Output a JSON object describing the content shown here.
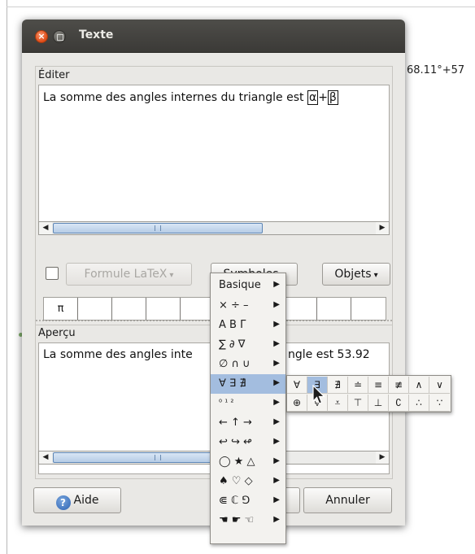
{
  "background": {
    "right_text": "68.11°+57"
  },
  "window": {
    "title": "Texte"
  },
  "edit": {
    "label": "Éditer",
    "text_prefix": "La somme des angles internes du triangle est",
    "token_alpha": "α",
    "op_plus": "+",
    "token_beta": "β",
    "scroll_left": "◀",
    "scroll_right": "▶"
  },
  "toolbar": {
    "latex_label": "Formule LaTeX",
    "symbols_label": "Symboles",
    "objects_label": "Objets",
    "dropdown_caret": "▾"
  },
  "quick_symbols": [
    "π",
    "",
    "",
    "",
    "",
    "",
    "",
    "",
    "",
    ""
  ],
  "preview": {
    "label": "Aperçu",
    "text_left": "La somme des angles inte",
    "text_right": "ngle est 53.92"
  },
  "footer": {
    "help_label": "Aide",
    "cancel_label": "Annuler"
  },
  "symbols_menu": {
    "items": [
      {
        "label": "Basique"
      },
      {
        "label": "× ÷ –"
      },
      {
        "label": "Α Β Γ"
      },
      {
        "label": "∑ ∂ ∇"
      },
      {
        "label": "∅ ∩ ∪"
      },
      {
        "label": "∀ ∃ ∄"
      },
      {
        "label": "⁰ ¹ ²"
      },
      {
        "label": "← ↑ →"
      },
      {
        "label": "↩ ↪ ↫"
      },
      {
        "label": "◯ ★ △"
      },
      {
        "label": "♠ ♡ ◇"
      },
      {
        "label": "⋐ ℂ ⅁"
      },
      {
        "label": "☚ ☛ ☜"
      }
    ],
    "submenu_arrow": "▶",
    "selected_index": 5
  },
  "logic_submenu": {
    "row1": [
      "∀",
      "∃",
      "∄",
      "≐",
      "≡",
      "≢",
      "∧",
      "∨"
    ],
    "row2": [
      "⊕",
      "⩝",
      "⩡",
      "⊤",
      "⊥",
      "∁",
      "∴",
      "∵"
    ],
    "hover": "∃"
  },
  "colors": {
    "titlebar": "#3f3e3a",
    "selection": "#a3bddf",
    "close_button": "#e2541f"
  }
}
